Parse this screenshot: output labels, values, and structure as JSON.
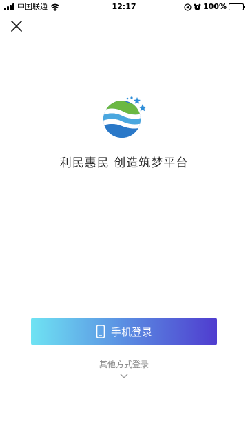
{
  "status_bar": {
    "carrier": "中国联通",
    "time": "12:17",
    "battery": "100%",
    "icons": [
      "signal-icon",
      "wifi-icon",
      "location-icon",
      "alarm-icon",
      "battery-icon"
    ]
  },
  "header": {
    "close_icon": "close-icon"
  },
  "brand": {
    "logo": "app-logo",
    "slogan": "利民惠民 创造筑梦平台"
  },
  "login": {
    "phone_label": "手机登录",
    "phone_icon": "phone-icon",
    "other_label": "其他方式登录",
    "other_icon": "chevron-down-icon"
  },
  "colors": {
    "gradient_start": "#6fe3f3",
    "gradient_end": "#4f3ccf",
    "logo_green": "#6bb843",
    "logo_blue": "#2a78c8",
    "star_blue": "#2f8ed8"
  }
}
